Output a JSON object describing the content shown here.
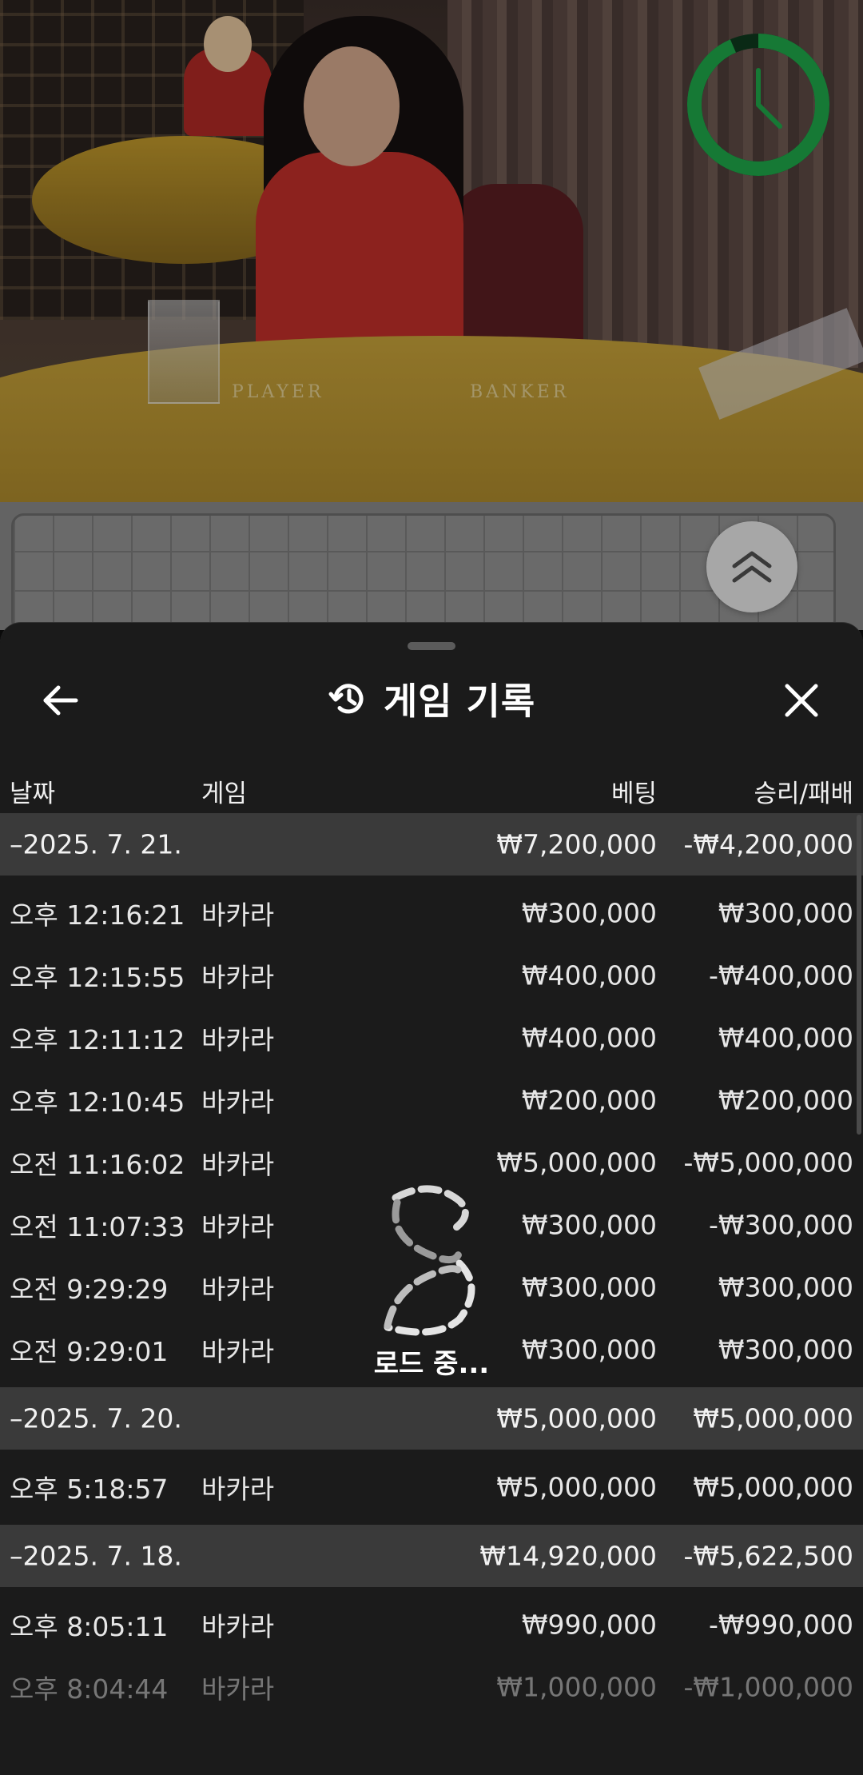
{
  "video": {
    "table_labels": [
      "PLAYER",
      "BANKER"
    ],
    "timer_color": "#1fa84a"
  },
  "sheet": {
    "title": "게임 기록",
    "columns": {
      "date": "날짜",
      "game": "게임",
      "bet": "베팅",
      "win_loss": "승리/패배"
    },
    "groups": [
      {
        "date": "–2025. 7. 21.",
        "bet_total": "₩7,200,000",
        "wl_total": "-₩4,200,000",
        "rows": [
          {
            "time": "오후 12:16:21",
            "game": "바카라",
            "bet": "₩300,000",
            "wl": "₩300,000"
          },
          {
            "time": "오후 12:15:55",
            "game": "바카라",
            "bet": "₩400,000",
            "wl": "-₩400,000"
          },
          {
            "time": "오후 12:11:12",
            "game": "바카라",
            "bet": "₩400,000",
            "wl": "₩400,000"
          },
          {
            "time": "오후 12:10:45",
            "game": "바카라",
            "bet": "₩200,000",
            "wl": "₩200,000"
          },
          {
            "time": "오전 11:16:02",
            "game": "바카라",
            "bet": "₩5,000,000",
            "wl": "-₩5,000,000"
          },
          {
            "time": "오전 11:07:33",
            "game": "바카라",
            "bet": "₩300,000",
            "wl": "-₩300,000"
          },
          {
            "time": "오전 9:29:29",
            "game": "바카라",
            "bet": "₩300,000",
            "wl": "₩300,000"
          },
          {
            "time": "오전 9:29:01",
            "game": "바카라",
            "bet": "₩300,000",
            "wl": "₩300,000"
          }
        ]
      },
      {
        "date": "–2025. 7. 20.",
        "bet_total": "₩5,000,000",
        "wl_total": "₩5,000,000",
        "rows": [
          {
            "time": "오후 5:18:57",
            "game": "바카라",
            "bet": "₩5,000,000",
            "wl": "₩5,000,000"
          }
        ]
      },
      {
        "date": "–2025. 7. 18.",
        "bet_total": "₩14,920,000",
        "wl_total": "-₩5,622,500",
        "rows": [
          {
            "time": "오후 8:05:11",
            "game": "바카라",
            "bet": "₩990,000",
            "wl": "-₩990,000"
          },
          {
            "time": "오후 8:04:44",
            "game": "바카라",
            "bet": "₩1,000,000",
            "wl": "-₩1,000,000"
          }
        ]
      }
    ],
    "loading_text": "로드 중..."
  },
  "icons": {
    "back": "arrow-left-icon",
    "history": "history-clock-icon",
    "close": "close-icon",
    "collapse": "double-chevron-up-icon",
    "timer": "timer-clock-icon",
    "loader": "loading-spinner-icon"
  }
}
